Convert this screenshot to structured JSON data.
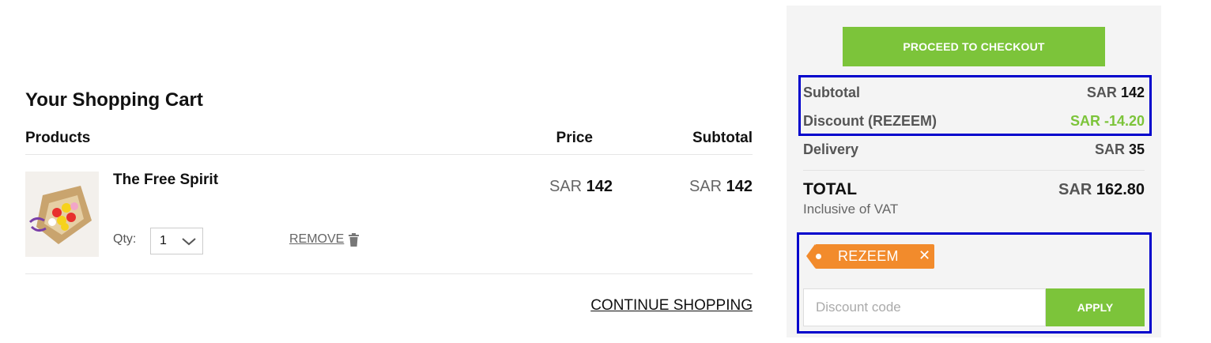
{
  "cart": {
    "title": "Your Shopping Cart",
    "columns": {
      "products": "Products",
      "price": "Price",
      "subtotal": "Subtotal"
    },
    "item": {
      "name": "The Free Spirit",
      "qty_label": "Qty:",
      "qty_value": "1",
      "remove_label": "REMOVE",
      "price_currency": "SAR",
      "price_amount": "142",
      "subtotal_currency": "SAR",
      "subtotal_amount": "142"
    },
    "continue_label": "CONTINUE SHOPPING"
  },
  "summary": {
    "checkout_label": "PROCEED TO CHECKOUT",
    "subtotal_label": "Subtotal",
    "subtotal_currency": "SAR",
    "subtotal_amount": "142",
    "discount_label": "Discount (REZEEM)",
    "discount_value": "SAR -14.20",
    "delivery_label": "Delivery",
    "delivery_currency": "SAR",
    "delivery_amount": "35",
    "total_label": "TOTAL",
    "vat_note": "Inclusive of VAT",
    "total_currency": "SAR",
    "total_amount": "162.80",
    "applied_coupon": "REZEEM",
    "coupon_remove_glyph": "✕",
    "discount_placeholder": "Discount code",
    "apply_label": "APPLY"
  },
  "colors": {
    "accent_green": "#7cc43a",
    "coupon_orange": "#f28b2c",
    "highlight_blue": "#0000cc"
  },
  "icons": [
    "chevron-down-icon",
    "trash-icon",
    "close-icon"
  ]
}
